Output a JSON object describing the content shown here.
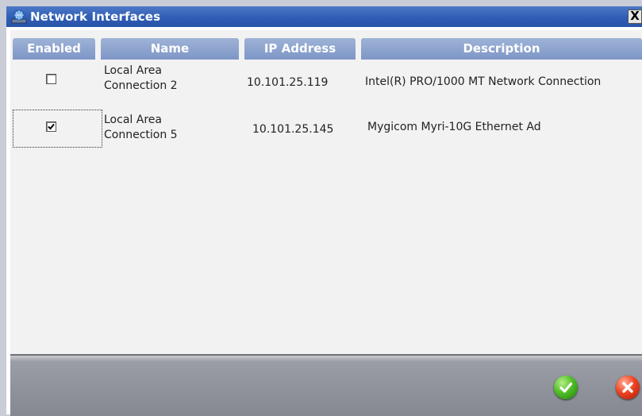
{
  "window": {
    "title": "Network Interfaces",
    "title_icon": "network-globe-icon",
    "close_glyph": "X"
  },
  "table": {
    "columns": [
      "Enabled",
      "Name",
      "IP Address",
      "Description"
    ],
    "rows": [
      {
        "enabled": false,
        "name_line1": "Local Area",
        "name_line2": "Connection 2",
        "ip": "10.101.25.119",
        "description": "Intel(R) PRO/1000 MT Network Connection"
      },
      {
        "enabled": true,
        "name_line1": "Local Area",
        "name_line2": "Connection 5",
        "ip": "10.101.25.145",
        "description": "Mygicom Myri-10G Ethernet Ad"
      }
    ]
  },
  "footer": {
    "ok_icon": "green-check-icon",
    "cancel_icon": "red-x-icon"
  },
  "colors": {
    "titlebar": "#2f5db5",
    "header": "#8ba1cd",
    "ok": "#4fbf24",
    "cancel": "#f04422"
  }
}
